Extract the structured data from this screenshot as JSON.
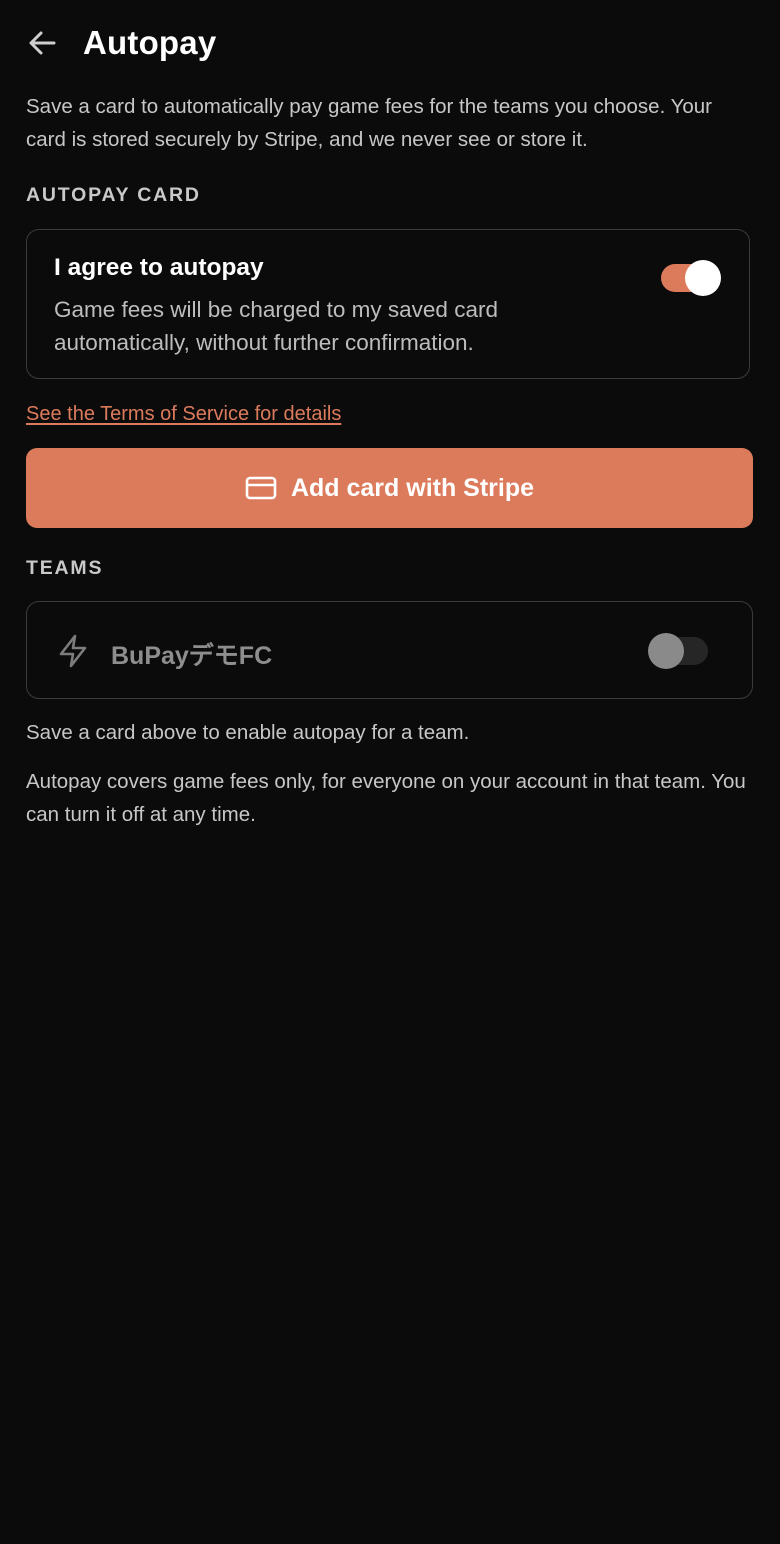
{
  "header": {
    "title": "Autopay",
    "back_icon": "arrow-left-icon"
  },
  "intro": {
    "text": "Save a card to automatically pay game fees for the teams you choose. Your card is stored securely by Stripe, and we never see or store it."
  },
  "autopay_card": {
    "section_label": "AUTOPAY CARD",
    "agree_title": "I agree to autopay",
    "agree_description": "Game fees will be charged to my saved card automatically, without further confirmation.",
    "agree_enabled": true,
    "terms_link": "See the Terms of Service for details",
    "add_card_label": "Add card with Stripe",
    "add_card_icon": "credit-card-icon"
  },
  "teams": {
    "section_label": "TEAMS",
    "items": [
      {
        "name": "BuPayデモFC",
        "icon": "lightning-bolt-icon",
        "enabled": false
      }
    ],
    "hint": "Save a card above to enable autopay for a team.",
    "footer_note": "Autopay covers game fees only, for everyone on your account in that team. You can turn it off at any time."
  },
  "colors": {
    "background": "#0b0b0b",
    "accent": "#dc7b5c",
    "border": "#3b3b3b"
  }
}
